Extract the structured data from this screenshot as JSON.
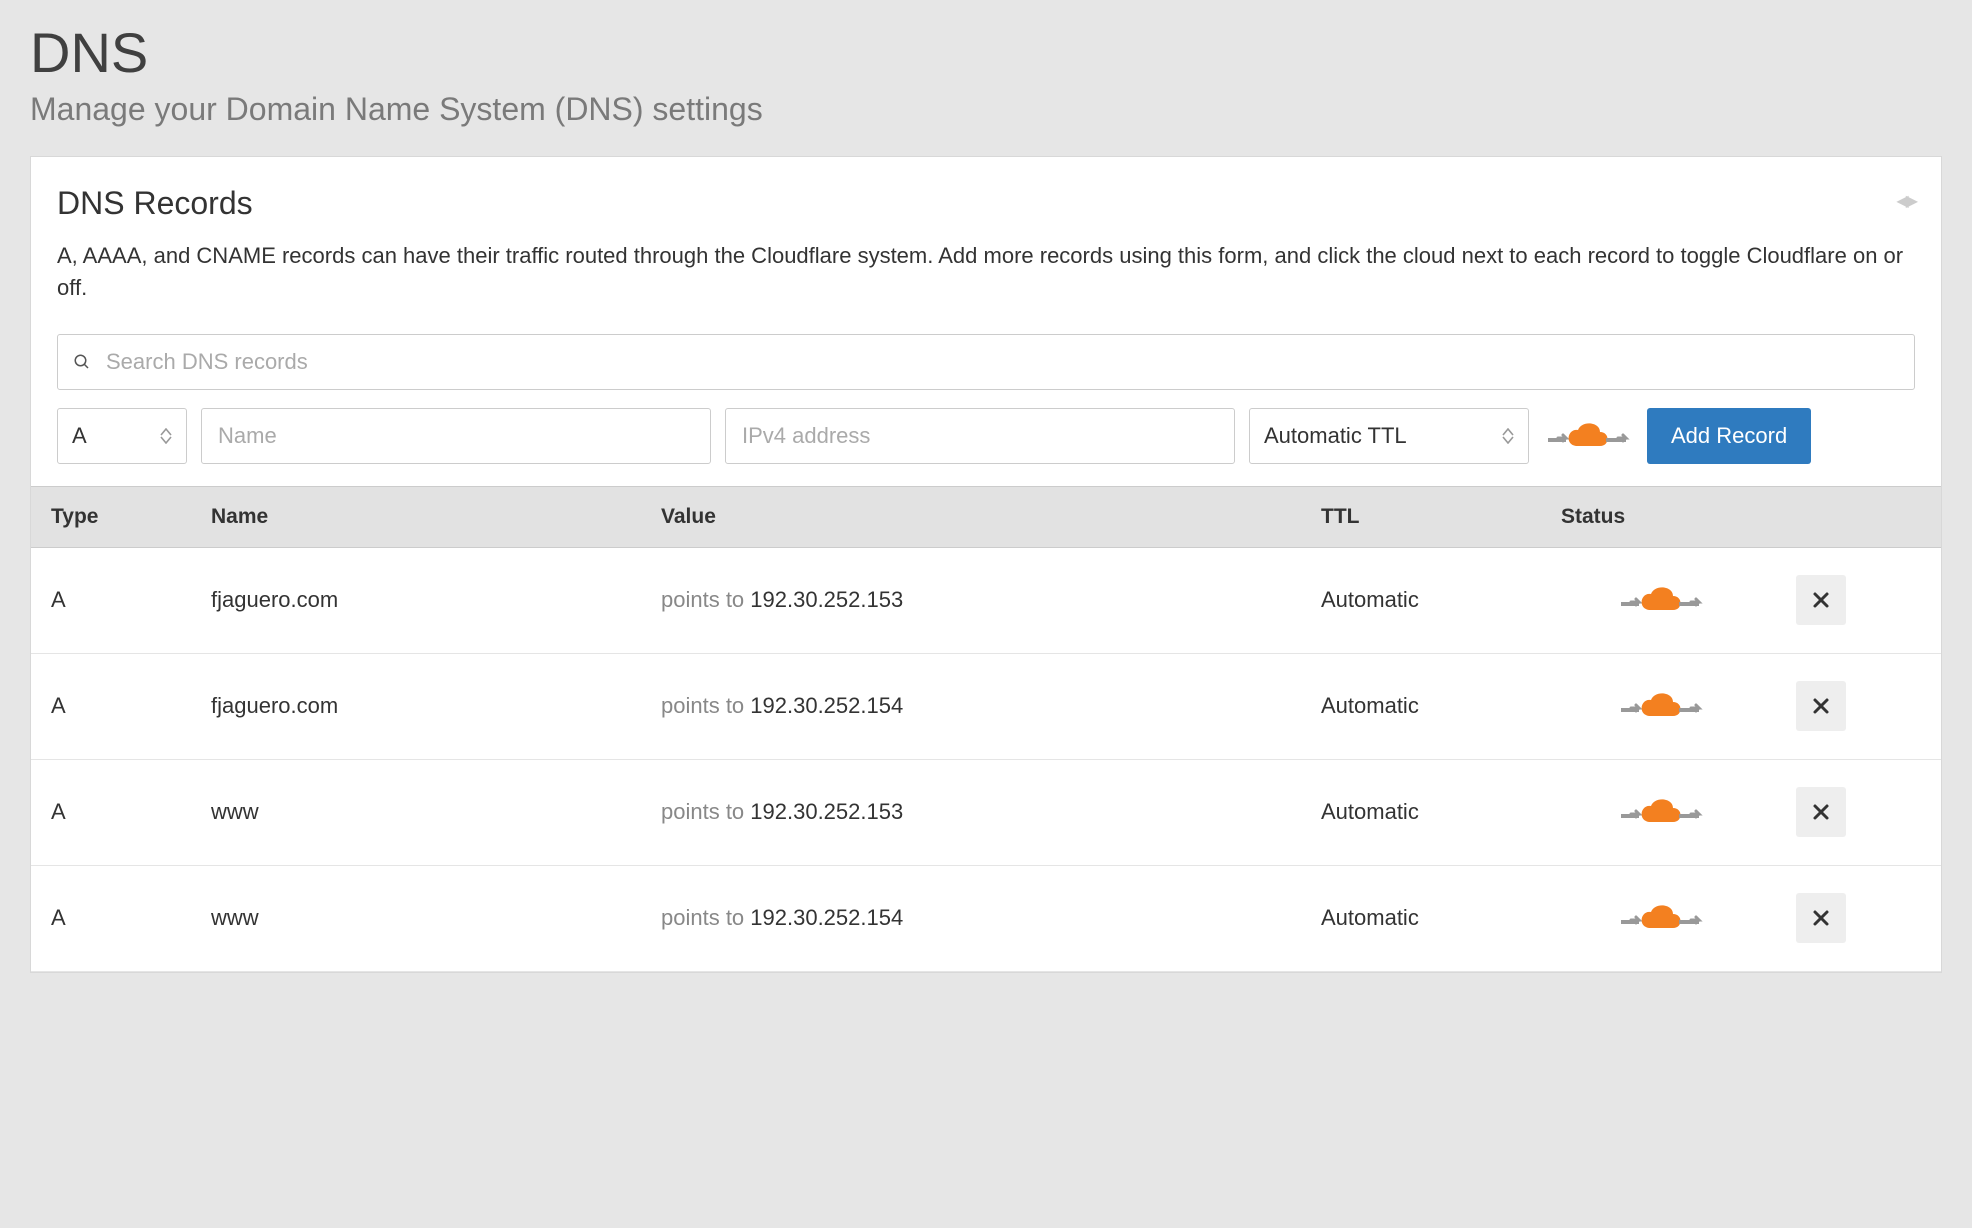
{
  "header": {
    "title": "DNS",
    "subtitle": "Manage your Domain Name System (DNS) settings"
  },
  "card": {
    "title": "DNS Records",
    "description": "A, AAAA, and CNAME records can have their traffic routed through the Cloudflare system. Add more records using this form, and click the cloud next to each record to toggle Cloudflare on or off."
  },
  "search": {
    "placeholder": "Search DNS records"
  },
  "form": {
    "type": "A",
    "name_placeholder": "Name",
    "value_placeholder": "IPv4 address",
    "ttl": "Automatic TTL",
    "add_button": "Add Record"
  },
  "table": {
    "headers": {
      "type": "Type",
      "name": "Name",
      "value": "Value",
      "ttl": "TTL",
      "status": "Status"
    },
    "value_prefix": "points to ",
    "rows": [
      {
        "type": "A",
        "name": "fjaguero.com",
        "value": "192.30.252.153",
        "ttl": "Automatic"
      },
      {
        "type": "A",
        "name": "fjaguero.com",
        "value": "192.30.252.154",
        "ttl": "Automatic"
      },
      {
        "type": "A",
        "name": "www",
        "value": "192.30.252.153",
        "ttl": "Automatic"
      },
      {
        "type": "A",
        "name": "www",
        "value": "192.30.252.154",
        "ttl": "Automatic"
      }
    ]
  }
}
